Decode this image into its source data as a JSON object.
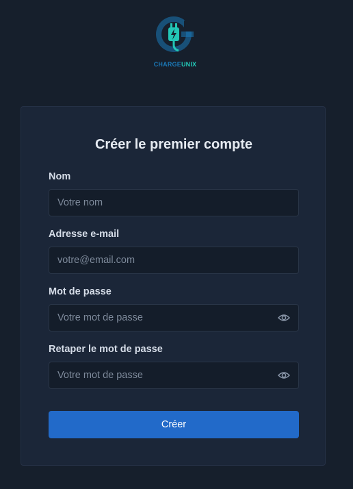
{
  "logo": {
    "text_part1": "CHARGE",
    "text_part2": "UNIX",
    "colors": {
      "ring": "#1b79b8",
      "plug": "#23c6b6"
    }
  },
  "form": {
    "title": "Créer le premier compte",
    "fields": [
      {
        "label": "Nom",
        "placeholder": "Votre nom",
        "value": "",
        "type": "text"
      },
      {
        "label": "Adresse e-mail",
        "placeholder": "votre@email.com",
        "value": "",
        "type": "email"
      },
      {
        "label": "Mot de passe",
        "placeholder": "Votre mot de passe",
        "value": "",
        "type": "password",
        "icon": "eye-icon"
      },
      {
        "label": "Retaper le mot de passe",
        "placeholder": "Votre mot de passe",
        "value": "",
        "type": "password",
        "icon": "eye-icon"
      }
    ],
    "submit_label": "Créer"
  },
  "colors": {
    "background": "#161f2c",
    "card": "#1b2638",
    "input": "#141d2a",
    "primary": "#226ac9"
  }
}
